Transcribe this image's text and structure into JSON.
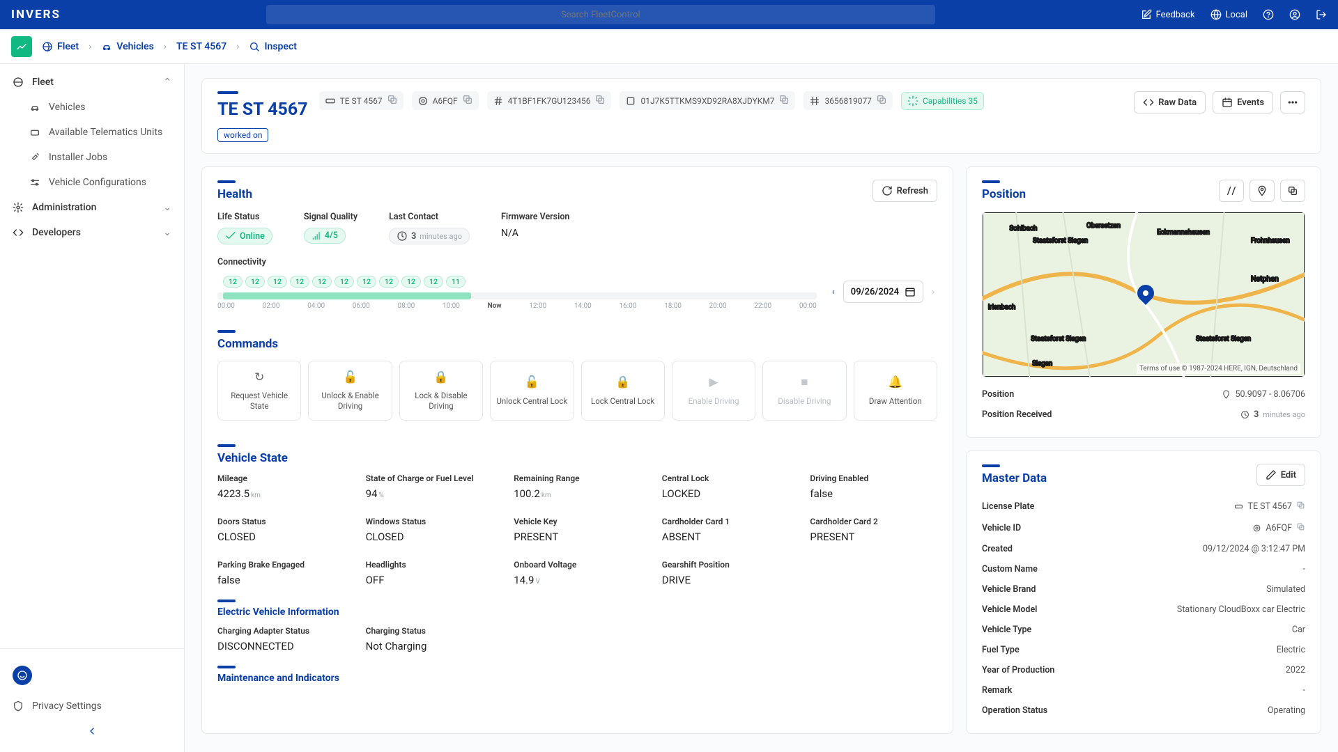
{
  "topbar": {
    "logo": "INVERS",
    "search_placeholder": "Search FleetControl",
    "feedback": "Feedback",
    "locale": "Local"
  },
  "breadcrumb": {
    "items": [
      "Fleet",
      "Vehicles",
      "TE ST 4567",
      "Inspect"
    ]
  },
  "sidebar": {
    "fleet": "Fleet",
    "vehicles": "Vehicles",
    "atu": "Available Telematics Units",
    "installer": "Installer Jobs",
    "vconfig": "Vehicle Configurations",
    "admin": "Administration",
    "devs": "Developers",
    "privacy": "Privacy Settings"
  },
  "header": {
    "title": "TE ST 4567",
    "chips": {
      "plate": "TE ST 4567",
      "vid": "A6FQF",
      "vin": "4T1BF1FK7GU123456",
      "qnr": "01J7K5TTKMS9XD92RA8XJDYKM7",
      "num": "3656819077",
      "cap": "Capabilities 35"
    },
    "tag": "worked on",
    "raw": "Raw Data",
    "events": "Events"
  },
  "health": {
    "title": "Health",
    "refresh": "Refresh",
    "life_label": "Life Status",
    "life_val": "Online",
    "sig_label": "Signal Quality",
    "sig_val": "4/5",
    "last_label": "Last Contact",
    "last_num": "3",
    "last_unit": "minutes ago",
    "fw_label": "Firmware Version",
    "fw_val": "N/A",
    "conn_label": "Connectivity",
    "date": "09/26/2024",
    "pills": [
      "12",
      "12",
      "12",
      "12",
      "12",
      "12",
      "12",
      "12",
      "12",
      "12",
      "11"
    ],
    "hours": [
      "00:00",
      "02:00",
      "04:00",
      "06:00",
      "08:00",
      "10:00",
      "Now",
      "12:00",
      "14:00",
      "16:00",
      "18:00",
      "20:00",
      "22:00",
      "00:00"
    ]
  },
  "commands": {
    "title": "Commands",
    "items": [
      {
        "label": "Request Vehicle State",
        "dis": false
      },
      {
        "label": "Unlock & Enable Driving",
        "dis": false
      },
      {
        "label": "Lock & Disable Driving",
        "dis": false
      },
      {
        "label": "Unlock Central Lock",
        "dis": false
      },
      {
        "label": "Lock Central Lock",
        "dis": false
      },
      {
        "label": "Enable Driving",
        "dis": true
      },
      {
        "label": "Disable Driving",
        "dis": true
      },
      {
        "label": "Draw Attention",
        "dis": false
      }
    ]
  },
  "vstate": {
    "title": "Vehicle State",
    "items": [
      {
        "l": "Mileage",
        "v": "4223.5",
        "u": "km"
      },
      {
        "l": "State of Charge or Fuel Level",
        "v": "94",
        "u": "%"
      },
      {
        "l": "Remaining Range",
        "v": "100.2",
        "u": "km"
      },
      {
        "l": "Central Lock",
        "v": "LOCKED"
      },
      {
        "l": "Driving Enabled",
        "v": "false"
      },
      {
        "l": "Doors Status",
        "v": "CLOSED"
      },
      {
        "l": "Windows Status",
        "v": "CLOSED"
      },
      {
        "l": "Vehicle Key",
        "v": "PRESENT"
      },
      {
        "l": "Cardholder Card 1",
        "v": "ABSENT"
      },
      {
        "l": "Cardholder Card 2",
        "v": "PRESENT"
      },
      {
        "l": "Parking Brake Engaged",
        "v": "false"
      },
      {
        "l": "Headlights",
        "v": "OFF"
      },
      {
        "l": "Onboard Voltage",
        "v": "14.9",
        "u": "V"
      },
      {
        "l": "Gearshift Position",
        "v": "DRIVE"
      }
    ],
    "ev_title": "Electric Vehicle Information",
    "ev_items": [
      {
        "l": "Charging Adapter Status",
        "v": "DISCONNECTED"
      },
      {
        "l": "Charging Status",
        "v": "Not Charging"
      }
    ],
    "maint_title": "Maintenance and Indicators"
  },
  "position": {
    "title": "Position",
    "attr": "Terms of use   © 1987-2024 HERE, IGN, Deutschland",
    "pos_label": "Position",
    "pos_val": "50.9097 - 8.06706",
    "recv_label": "Position Received",
    "recv_num": "3",
    "recv_unit": "minutes ago"
  },
  "master": {
    "title": "Master Data",
    "edit": "Edit",
    "rows": [
      {
        "k": "License Plate",
        "v": "TE ST 4567",
        "copy": true,
        "pre": "plate"
      },
      {
        "k": "Vehicle ID",
        "v": "A6FQF",
        "copy": true,
        "pre": "target"
      },
      {
        "k": "Created",
        "v": "09/12/2024 @ 3:12:47 PM"
      },
      {
        "k": "Custom Name",
        "v": "-"
      },
      {
        "k": "Vehicle Brand",
        "v": "Simulated"
      },
      {
        "k": "Vehicle Model",
        "v": "Stationary CloudBoxx car Electric"
      },
      {
        "k": "Vehicle Type",
        "v": "Car"
      },
      {
        "k": "Fuel Type",
        "v": "Electric"
      },
      {
        "k": "Year of Production",
        "v": "2022"
      },
      {
        "k": "Remark",
        "v": "-"
      },
      {
        "k": "Operation Status",
        "v": "Operating"
      }
    ]
  }
}
